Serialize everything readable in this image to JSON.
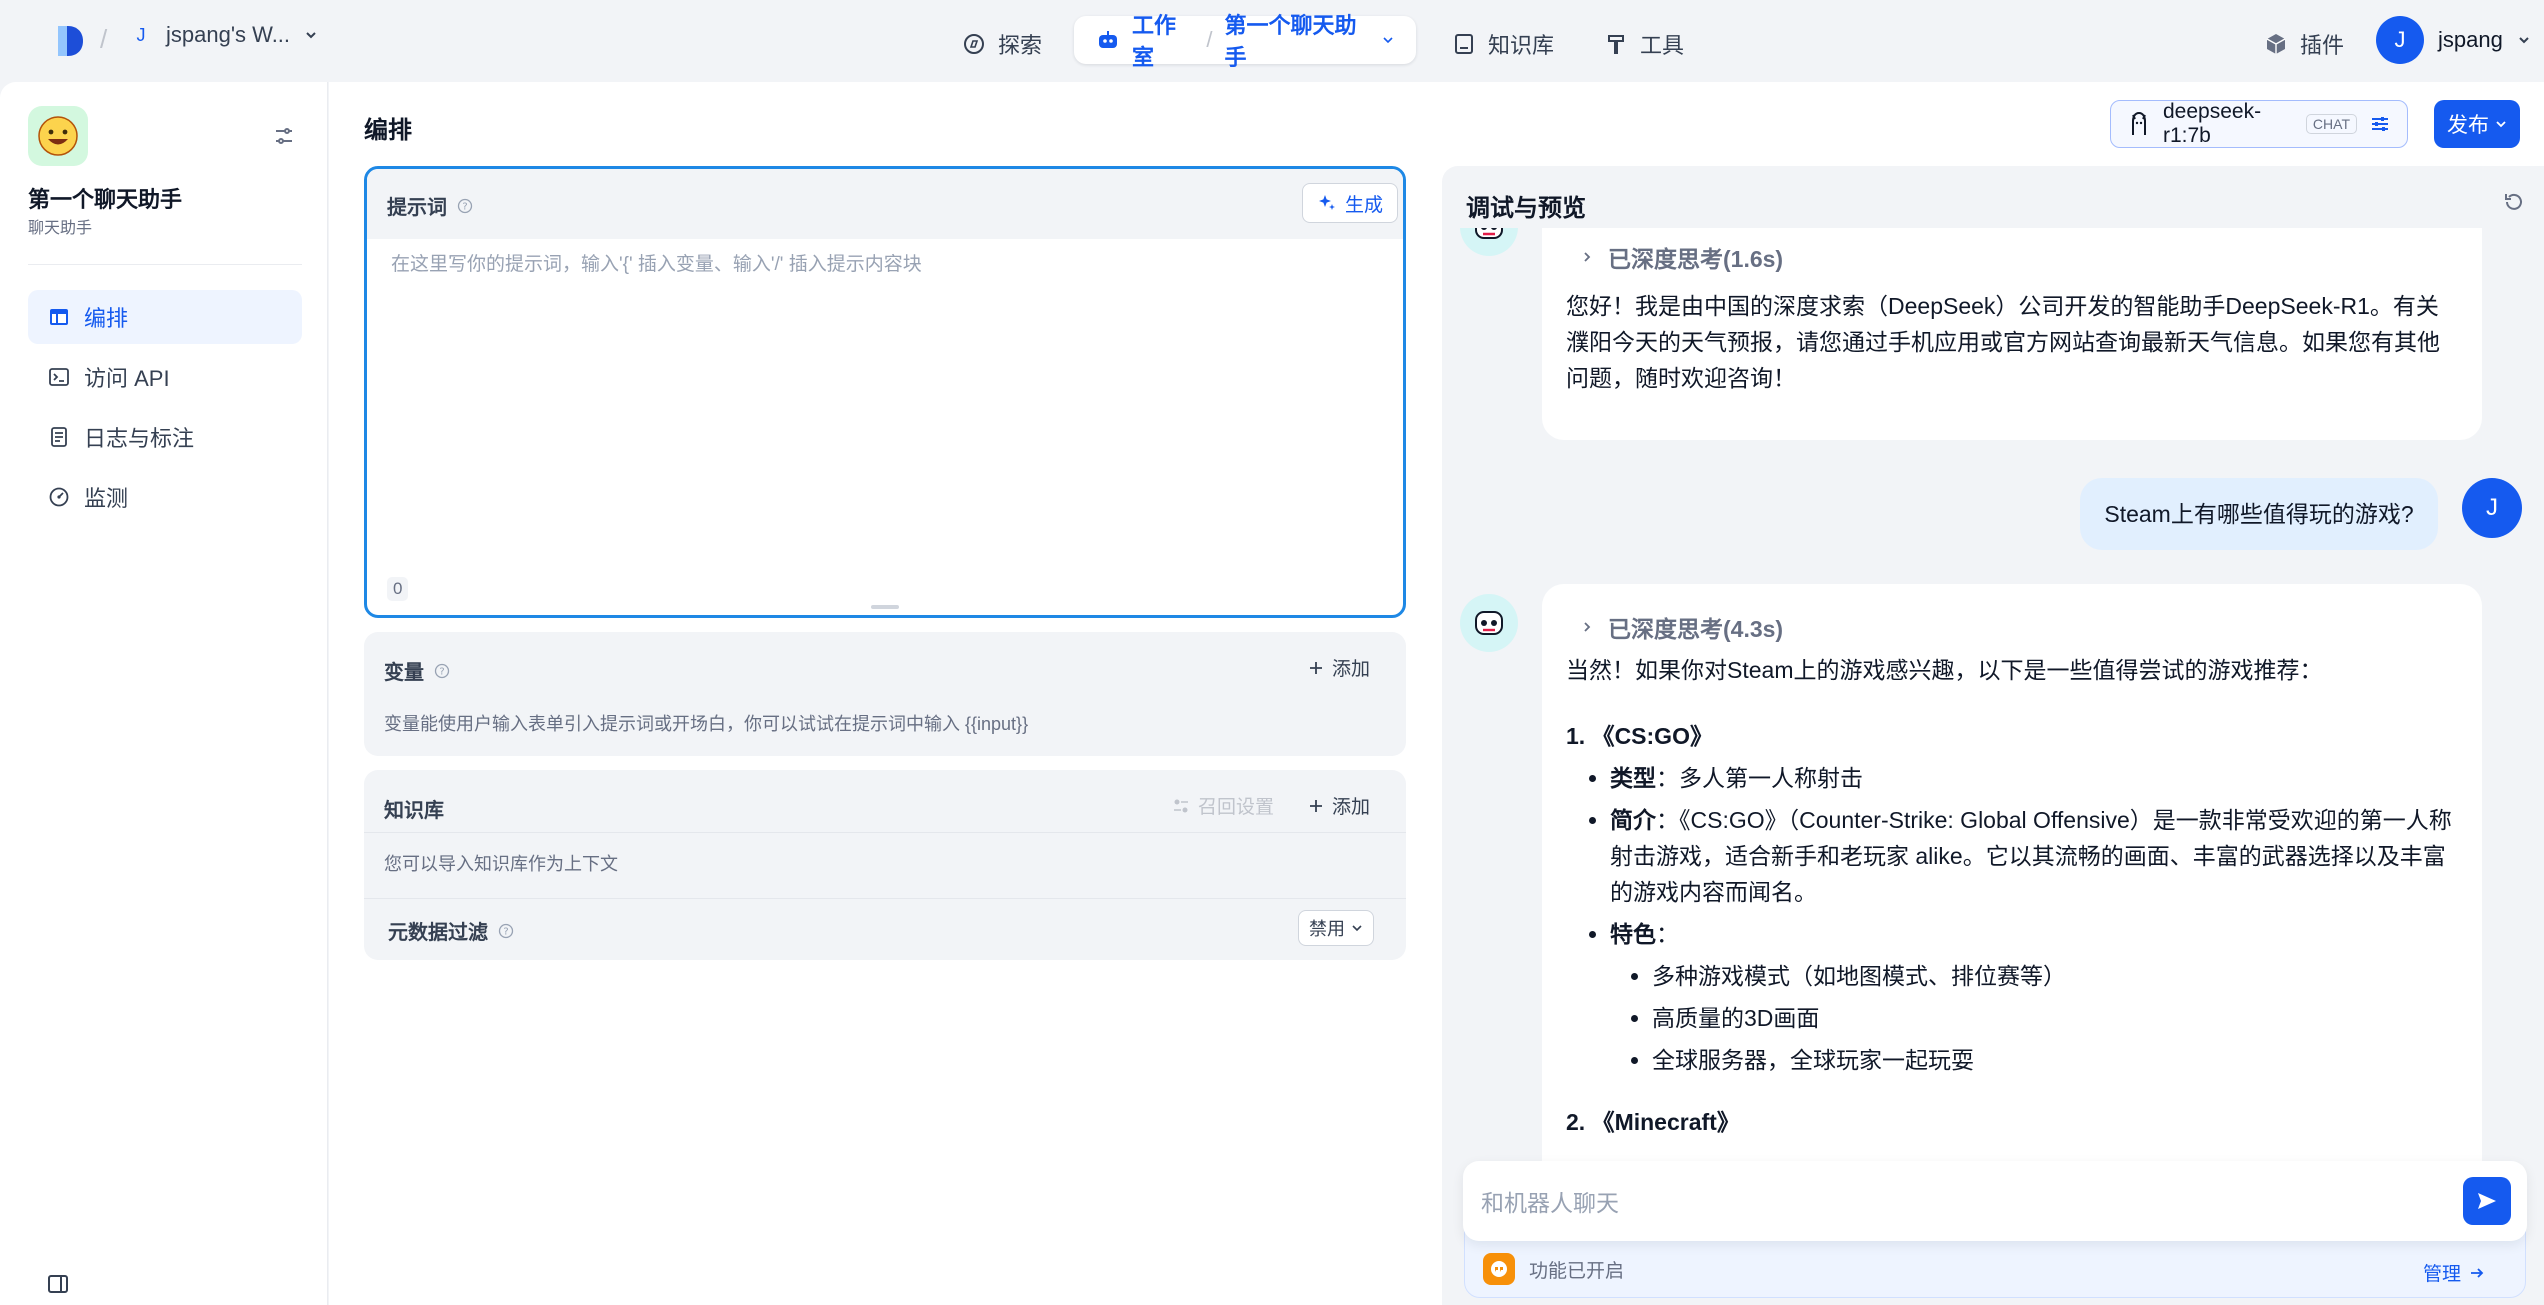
{
  "topbar": {
    "workspace_initial": "J",
    "workspace_name": "jspang's W...",
    "nav_explore": "探索",
    "nav_studio": "工作室",
    "app_name": "第一个聊天助手",
    "nav_knowledge": "知识库",
    "nav_tools": "工具",
    "plugins": "插件",
    "user_initial": "J",
    "user_name": "jspang"
  },
  "sidebar": {
    "app_title": "第一个聊天助手",
    "app_subtitle": "聊天助手",
    "items": [
      {
        "label": "编排",
        "icon": "layout-icon"
      },
      {
        "label": "访问 API",
        "icon": "terminal-icon"
      },
      {
        "label": "日志与标注",
        "icon": "file-list-icon"
      },
      {
        "label": "监测",
        "icon": "dashboard-icon"
      }
    ]
  },
  "editor": {
    "title": "编排",
    "model_name": "deepseek-r1:7b",
    "model_badge": "CHAT",
    "publish": "发布",
    "prompt_label": "提示词",
    "generate": "生成",
    "prompt_placeholder": "在这里写你的提示词，输入'{' 插入变量、输入'/' 插入提示内容块",
    "char_count": "0",
    "variables_label": "变量",
    "add": "添加",
    "variables_hint": "变量能使用户输入表单引入提示词或开场白，你可以试试在提示词中输入 {{input}}",
    "knowledge_label": "知识库",
    "recall_settings": "召回设置",
    "knowledge_hint": "您可以导入知识库作为上下文",
    "metadata_filter": "元数据过滤",
    "metadata_value": "禁用"
  },
  "chat": {
    "title": "调试与预览",
    "msg1_thinking": "已深度思考(1.6s)",
    "msg1_text": "您好！我是由中国的深度求索（DeepSeek）公司开发的智能助手DeepSeek-R1。有关濮阳今天的天气预报，请您通过手机应用或官方网站查询最新天气信息。如果您有其他问题，随时欢迎咨询！",
    "user_msg": "Steam上有哪些值得玩的游戏?",
    "msg2_thinking": "已深度思考(4.3s)",
    "msg2_intro": "当然！如果你对Steam上的游戏感兴趣，以下是一些值得尝试的游戏推荐：",
    "game1_title": "1. 《CS:GO》",
    "type_label": "类型",
    "game1_type": "：多人第一人称射击",
    "intro_label": "简介",
    "game1_intro": "：《CS:GO》（Counter-Strike: Global Offensive）是一款非常受欢迎的第一人称射击游戏，适合新手和老玩家 alike。它以其流畅的画面、丰富的武器选择以及丰富的游戏内容而闻名。",
    "feature_label": "特色",
    "feature_colon": "：",
    "features": [
      "多种游戏模式（如地图模式、排位赛等）",
      "高质量的3D画面",
      "全球服务器，全球玩家一起玩耍"
    ],
    "game2_title": "2. 《Minecraft》",
    "input_placeholder": "和机器人聊天",
    "feature_on": "功能已开启",
    "manage": "管理"
  },
  "colors": {
    "primary": "#155aef",
    "bg": "#f2f4f7",
    "user_bubble": "#e1effe"
  }
}
